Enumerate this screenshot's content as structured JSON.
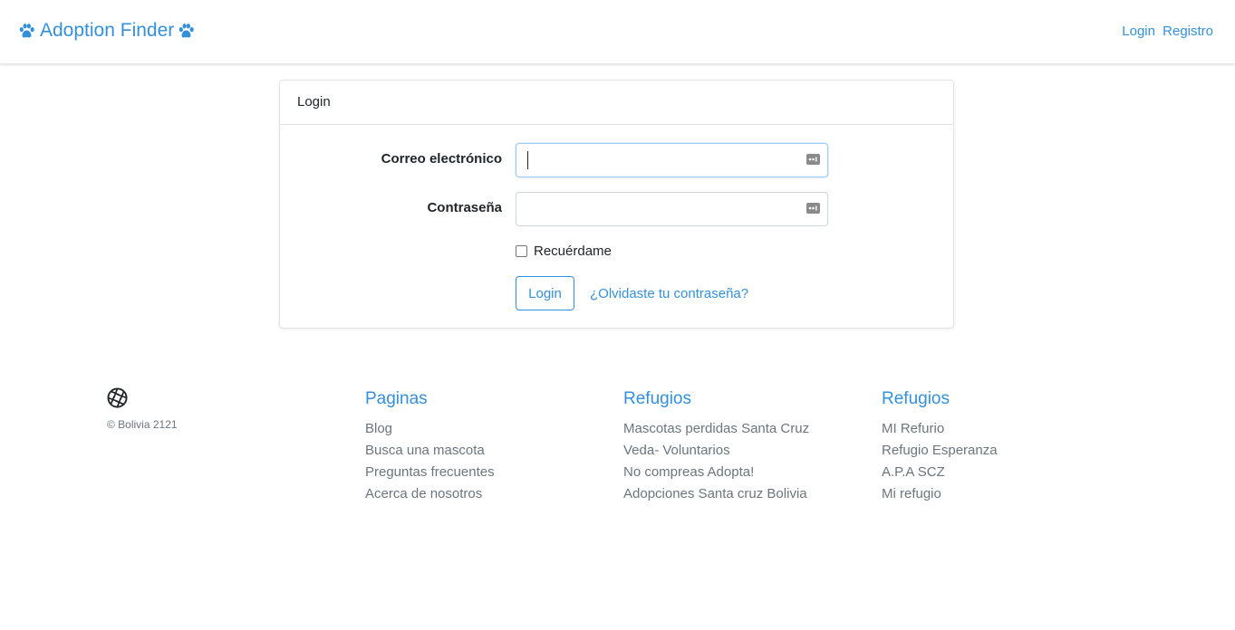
{
  "navbar": {
    "brand": "Adoption Finder",
    "links": [
      "Login",
      "Registro"
    ]
  },
  "login_card": {
    "header": "Login",
    "email_label": "Correo electrónico",
    "email_value": "",
    "password_label": "Contraseña",
    "password_value": "",
    "remember_label": "Recuérdame",
    "remember_checked": false,
    "submit_label": "Login",
    "forgot_link": "¿Olvidaste tu contraseña?"
  },
  "footer": {
    "copyright": "© Bolivia 2121",
    "columns": [
      {
        "title": "Paginas",
        "items": [
          "Blog",
          "Busca una mascota",
          "Preguntas frecuentes",
          "Acerca de nosotros"
        ]
      },
      {
        "title": "Refugios",
        "items": [
          "Mascotas perdidas Santa Cruz",
          "Veda- Voluntarios",
          "No compreas Adopta!",
          "Adopciones Santa cruz Bolivia"
        ]
      },
      {
        "title": "Refugios",
        "items": [
          "MI Refurio",
          "Refugio Esperanza",
          "A.P.A SCZ",
          "Mi refugio"
        ]
      }
    ]
  },
  "icons": {
    "brand_left": "paw-icon",
    "brand_right": "paw-icon",
    "input_key": "password-manager-key-icon",
    "footer_logo": "aperture-icon"
  },
  "colors": {
    "primary": "#3490dc",
    "muted_text": "#6c757d",
    "border": "#ced4da"
  }
}
